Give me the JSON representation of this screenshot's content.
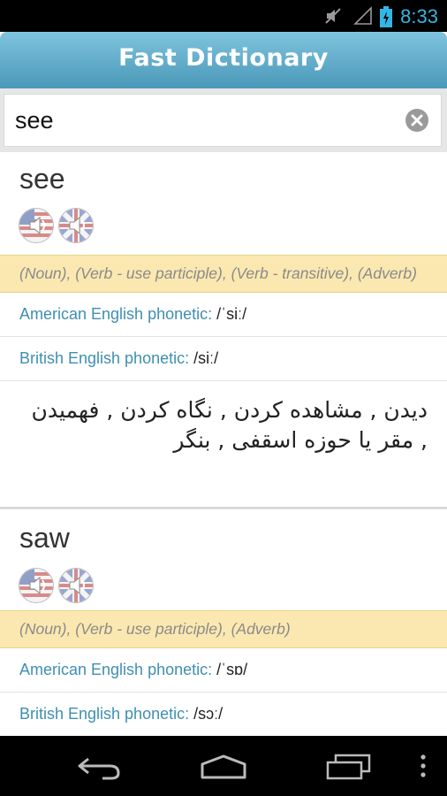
{
  "status": {
    "time": "8:33"
  },
  "app": {
    "title": "Fast Dictionary"
  },
  "search": {
    "value": "see"
  },
  "entries": [
    {
      "word": "see",
      "pos": "(Noun), (Verb - use participle), (Verb - transitive), (Adverb)",
      "american_label": "American English phonetic:",
      "american_value": "/ˈsiː/",
      "british_label": "British English phonetic:",
      "british_value": "/siː/",
      "translation": "دیدن , مشاهده کردن , نگاه کردن , فهمیدن , مقر یا حوزه اسقفی , بنگر"
    },
    {
      "word": "saw",
      "pos": "(Noun), (Verb - use participle), (Adverb)",
      "american_label": "American English phonetic:",
      "american_value": "/ˈsɒ/",
      "british_label": "British English phonetic:",
      "british_value": "/sɔː/"
    }
  ],
  "icons": {
    "statusbar": [
      "muted-icon",
      "signal-icon",
      "battery-icon"
    ],
    "speakers": [
      "us-speaker-icon",
      "uk-speaker-icon"
    ],
    "nav": [
      "back-icon",
      "home-icon",
      "recent-apps-icon",
      "overflow-menu-icon"
    ]
  },
  "colors": {
    "accent": "#33b5e5",
    "appbar": "#5aa9c9",
    "pos_bg": "#fbe8b0",
    "phonetic_label": "#3f8fb0"
  }
}
